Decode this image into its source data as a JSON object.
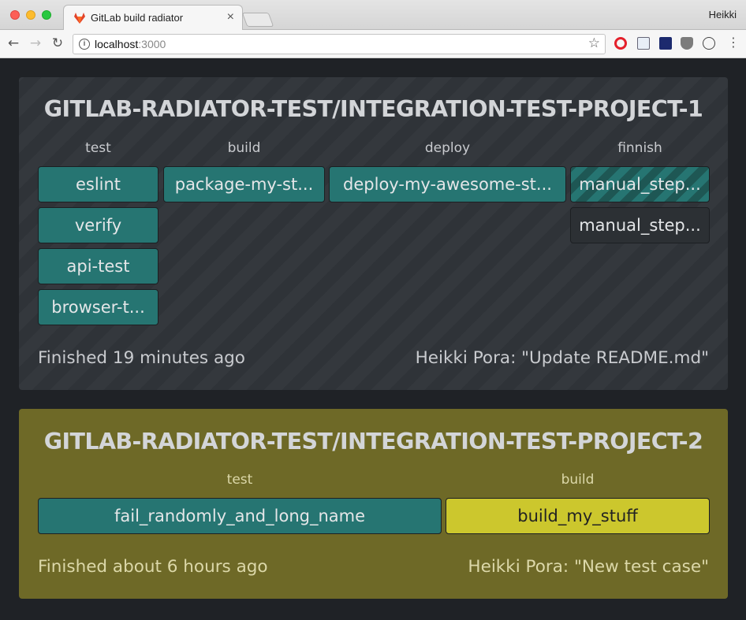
{
  "browser": {
    "tab_title": "GitLab build radiator",
    "tab_close": "×",
    "user_name": "Heikki",
    "url_host": "localhost",
    "url_port": ":3000",
    "nav_back": "←",
    "nav_forward": "→",
    "nav_reload": "↻",
    "star": "☆",
    "menu": "⋮",
    "info": "i"
  },
  "projects": [
    {
      "title": "GITLAB-RADIATOR-TEST/INTEGRATION-TEST-PROJECT-1",
      "footer_left": "Finished 19 minutes ago",
      "footer_right": "Heikki Pora: \"Update README.md\"",
      "stages": [
        {
          "name": "test",
          "jobs": [
            {
              "name": "eslint",
              "status": "success"
            },
            {
              "name": "verify",
              "status": "success"
            },
            {
              "name": "api-test",
              "status": "success"
            },
            {
              "name": "browser-t...",
              "status": "success"
            }
          ]
        },
        {
          "name": "build",
          "jobs": [
            {
              "name": "package-my-st...",
              "status": "success"
            }
          ]
        },
        {
          "name": "deploy",
          "jobs": [
            {
              "name": "deploy-my-awesome-st...",
              "status": "success"
            }
          ]
        },
        {
          "name": "finnish",
          "jobs": [
            {
              "name": "manual_step...",
              "status": "manual-running"
            },
            {
              "name": "manual_step...",
              "status": "created"
            }
          ]
        }
      ]
    },
    {
      "title": "GITLAB-RADIATOR-TEST/INTEGRATION-TEST-PROJECT-2",
      "footer_left": "Finished about 6 hours ago",
      "footer_right": "Heikki Pora: \"New test case\"",
      "stages": [
        {
          "name": "test",
          "jobs": [
            {
              "name": "fail_randomly_and_long_name",
              "status": "success"
            }
          ]
        },
        {
          "name": "build",
          "jobs": [
            {
              "name": "build_my_stuff",
              "status": "running-yellow"
            }
          ]
        }
      ]
    }
  ],
  "colors": {
    "background": "#1f2226",
    "success": "#267572",
    "project_failed_bg": "#6e6927",
    "running": "#ccc72d"
  }
}
